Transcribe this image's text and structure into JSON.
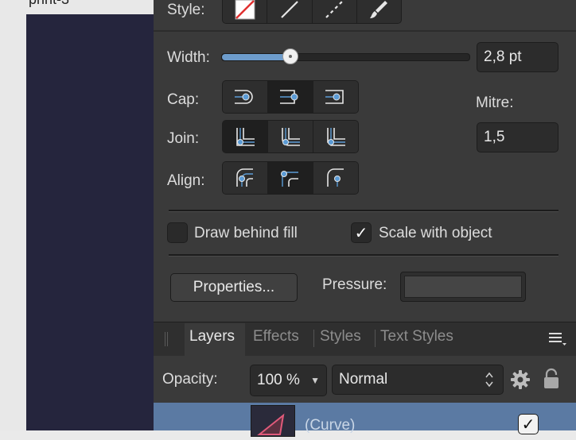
{
  "document": {
    "title": "print-3"
  },
  "stroke": {
    "style_label": "Style:",
    "width_label": "Width:",
    "width_value": "2,8 pt",
    "width_fraction": 0.28,
    "cap_label": "Cap:",
    "join_label": "Join:",
    "align_label": "Align:",
    "mitre_label": "Mitre:",
    "mitre_value": "1,5",
    "draw_behind_fill_label": "Draw behind fill",
    "draw_behind_fill_checked": false,
    "scale_with_object_label": "Scale with object",
    "scale_with_object_checked": true,
    "properties_label": "Properties...",
    "pressure_label": "Pressure:"
  },
  "tabs": [
    {
      "label": "Layers",
      "active": true
    },
    {
      "label": "Effects",
      "active": false
    },
    {
      "label": "Styles",
      "active": false
    },
    {
      "label": "Text Styles",
      "active": false
    }
  ],
  "layers": {
    "opacity_label": "Opacity:",
    "opacity_value": "100 %",
    "blend_mode": "Normal",
    "rows": [
      {
        "name": "(Curve)",
        "visible": true
      }
    ]
  },
  "colors": {
    "accent": "#5b9bd5",
    "selection": "#5b7aa3",
    "panel": "#3a3a3a",
    "artboard": "#25253d"
  }
}
